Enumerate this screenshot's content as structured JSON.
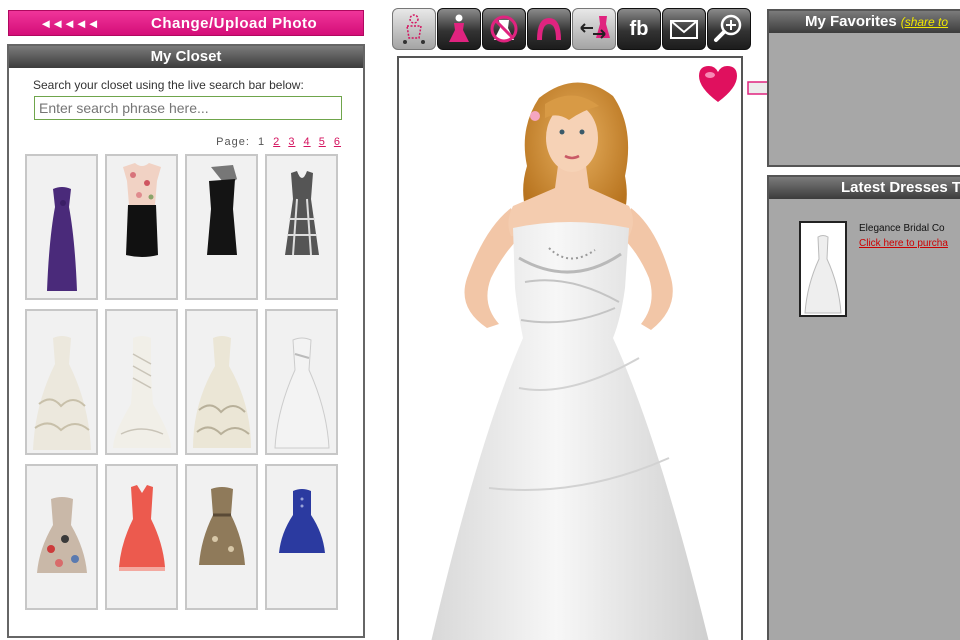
{
  "upload": {
    "arrows": "◄◄◄◄◄",
    "label": "Change/Upload  Photo"
  },
  "closet": {
    "title": "My Closet",
    "hint": "Search your closet using the live search bar below:",
    "search_placeholder": "Enter search phrase here...",
    "pager": {
      "label": "Page:",
      "current": "1",
      "pages": [
        "2",
        "3",
        "4",
        "5",
        "6"
      ]
    },
    "items": [
      {
        "icon": "purple-gown-icon",
        "color": "#4a2a7a"
      },
      {
        "icon": "floral-top-black-skirt-icon",
        "color": "#111111"
      },
      {
        "icon": "black-one-shoulder-dress-icon",
        "color": "#141414"
      },
      {
        "icon": "plaid-dress-icon",
        "color": "#555555"
      },
      {
        "icon": "ruffled-bridal-gown-icon",
        "color": "#ece8dd"
      },
      {
        "icon": "mermaid-bridal-gown-icon",
        "color": "#f1efe8"
      },
      {
        "icon": "bubble-bridal-gown-icon",
        "color": "#ebe6d6"
      },
      {
        "icon": "strapless-bridal-gown-icon",
        "color": "#f3f3f3"
      },
      {
        "icon": "printed-cocktail-dress-icon",
        "color": "#c9b8a8"
      },
      {
        "icon": "coral-dress-icon",
        "color": "#ec5a4e"
      },
      {
        "icon": "bronze-cocktail-dress-icon",
        "color": "#8f7a5a"
      },
      {
        "icon": "blue-cocktail-dress-icon",
        "color": "#2b3aa0"
      }
    ]
  },
  "toolbar": {
    "fb_label": "fb",
    "tools": [
      "pose-icon",
      "dress-on-icon",
      "remove-dress-icon",
      "arch-icon",
      "swap-icon",
      "facebook-icon",
      "email-icon",
      "zoom-icon"
    ]
  },
  "favorites": {
    "title": "My Favorites",
    "share_label": "(share to"
  },
  "latest": {
    "title": "Latest Dresses T",
    "item_name": "Elegance Bridal Co",
    "item_link": "Click here to purcha"
  },
  "colors": {
    "brand_pink": "#e0237f",
    "panel_gray": "#a7a7a7",
    "link_red": "#cc0000"
  }
}
